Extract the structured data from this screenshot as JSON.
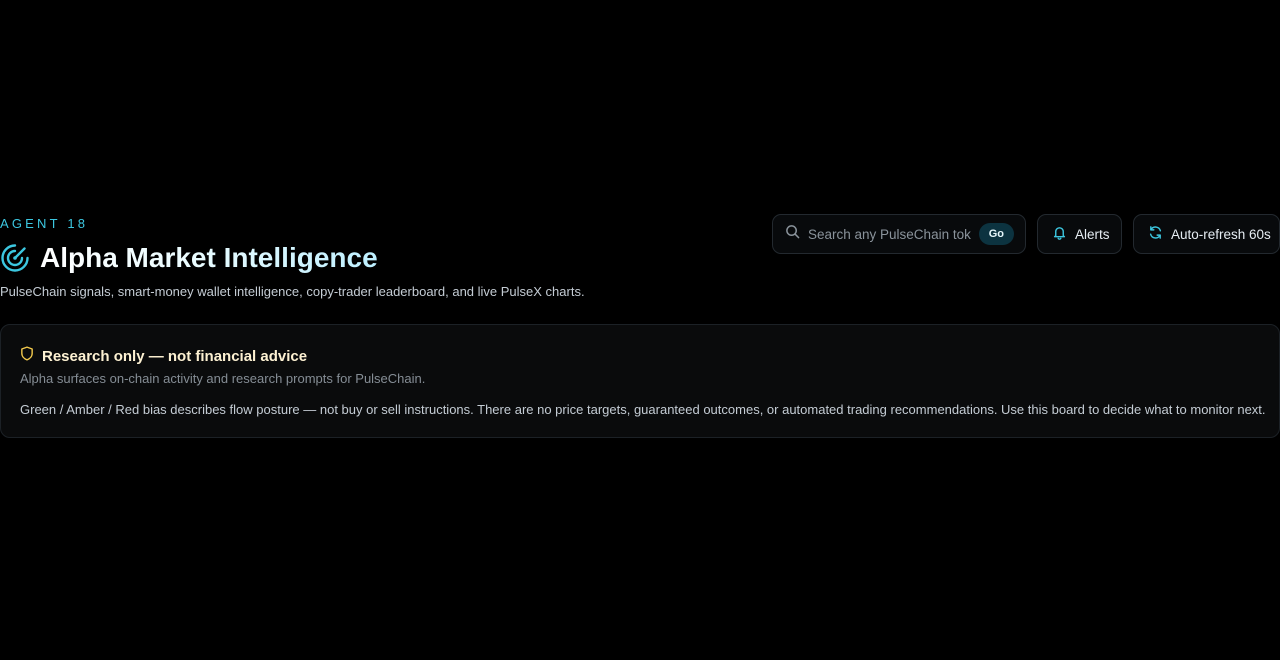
{
  "header": {
    "eyebrow": "AGENT 18",
    "title": "Alpha Market Intelligence",
    "subtitle": "PulseChain signals, smart-money wallet intelligence, copy-trader leaderboard, and live PulseX charts.",
    "icon": "radar-icon",
    "accent_color": "#3cc7e0"
  },
  "controls": {
    "search": {
      "placeholder": "Search any PulseChain token",
      "value": "",
      "go_label": "Go",
      "icon": "search-icon"
    },
    "alerts": {
      "label": "Alerts",
      "icon": "bell-icon"
    },
    "refresh": {
      "label": "Auto-refresh 60s",
      "icon": "refresh-icon"
    }
  },
  "notice": {
    "title": "Research only — not financial advice",
    "subtitle": "Alpha surfaces on-chain activity and research prompts for PulseChain.",
    "body": "Green / Amber / Red bias describes flow posture — not buy or sell instructions. There are no price targets, guaranteed outcomes, or automated trading recommendations. Use this board to decide what to monitor next.",
    "icon": "shield-icon",
    "icon_color": "#f2c94c"
  }
}
